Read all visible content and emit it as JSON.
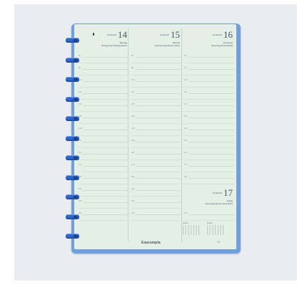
{
  "days": [
    {
      "month": "JANUAR",
      "number": "14",
      "weekday": "Dienstag",
      "saints": "Montag Januar Ruhetag Kalender"
    },
    {
      "month": "JANUAR",
      "number": "15",
      "weekday": "Mittwoch",
      "saints": "Tag Namenstag Kalender Woche"
    },
    {
      "month": "JANUAR",
      "number": "16",
      "weekday": "Donnerstag",
      "saints": "Namenstag Januar Ruhetag"
    },
    {
      "month": "JANUAR",
      "number": "17",
      "weekday": "Freitag",
      "saints": "Namenstag Kalender Januar Woche"
    }
  ],
  "hours": [
    "8h",
    "9h",
    "10h",
    "11h",
    "12h",
    "13h",
    "14h",
    "15h",
    "16h",
    "17h",
    "18h",
    "19h",
    "20h",
    "21h"
  ],
  "brand": "Exacompta",
  "mini_calendars": [
    {
      "title": "Janvier"
    },
    {
      "title": "Février"
    }
  ],
  "page_number": "15"
}
